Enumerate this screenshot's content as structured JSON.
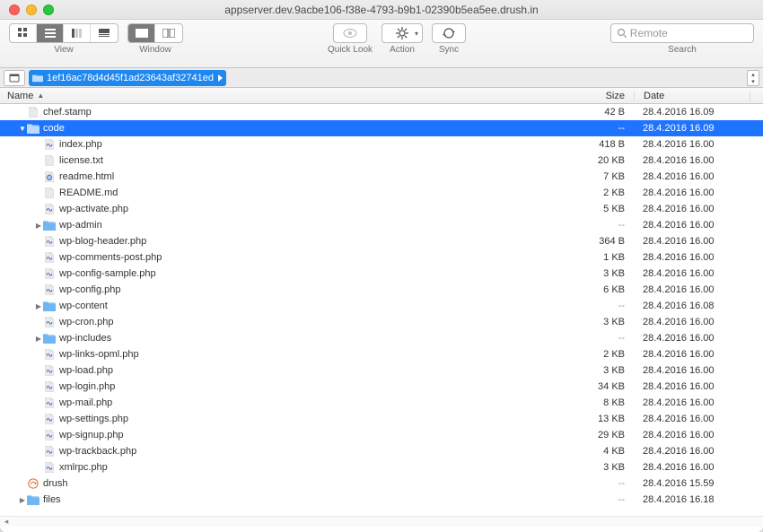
{
  "window": {
    "title": "appserver.dev.9acbe106-f38e-4793-b9b1-02390b5ea5ee.drush.in"
  },
  "toolbar": {
    "view_label": "View",
    "window_label": "Window",
    "quicklook_label": "Quick Look",
    "action_label": "Action",
    "sync_label": "Sync",
    "search_label": "Search",
    "search_placeholder": "Remote"
  },
  "pathbar": {
    "crumb": "1ef16ac78d4d45f1ad23643af32741ed"
  },
  "columns": {
    "name": "Name",
    "size": "Size",
    "date": "Date"
  },
  "rows": [
    {
      "indent": 0,
      "icon": "file",
      "disclosure": "",
      "name": "chef.stamp",
      "size": "42 B",
      "date": "28.4.2016 16.09"
    },
    {
      "indent": 0,
      "icon": "folder",
      "disclosure": "open",
      "name": "code",
      "size": "--",
      "date": "28.4.2016 16.09",
      "selected": true
    },
    {
      "indent": 1,
      "icon": "php",
      "disclosure": "",
      "name": "index.php",
      "size": "418 B",
      "date": "28.4.2016 16.00"
    },
    {
      "indent": 1,
      "icon": "file",
      "disclosure": "",
      "name": "license.txt",
      "size": "20 KB",
      "date": "28.4.2016 16.00"
    },
    {
      "indent": 1,
      "icon": "html",
      "disclosure": "",
      "name": "readme.html",
      "size": "7 KB",
      "date": "28.4.2016 16.00"
    },
    {
      "indent": 1,
      "icon": "file",
      "disclosure": "",
      "name": "README.md",
      "size": "2 KB",
      "date": "28.4.2016 16.00"
    },
    {
      "indent": 1,
      "icon": "php",
      "disclosure": "",
      "name": "wp-activate.php",
      "size": "5 KB",
      "date": "28.4.2016 16.00"
    },
    {
      "indent": 1,
      "icon": "folder",
      "disclosure": "closed",
      "name": "wp-admin",
      "size": "--",
      "date": "28.4.2016 16.00"
    },
    {
      "indent": 1,
      "icon": "php",
      "disclosure": "",
      "name": "wp-blog-header.php",
      "size": "364 B",
      "date": "28.4.2016 16.00"
    },
    {
      "indent": 1,
      "icon": "php",
      "disclosure": "",
      "name": "wp-comments-post.php",
      "size": "1 KB",
      "date": "28.4.2016 16.00"
    },
    {
      "indent": 1,
      "icon": "php",
      "disclosure": "",
      "name": "wp-config-sample.php",
      "size": "3 KB",
      "date": "28.4.2016 16.00"
    },
    {
      "indent": 1,
      "icon": "php",
      "disclosure": "",
      "name": "wp-config.php",
      "size": "6 KB",
      "date": "28.4.2016 16.00"
    },
    {
      "indent": 1,
      "icon": "folder",
      "disclosure": "closed",
      "name": "wp-content",
      "size": "--",
      "date": "28.4.2016 16.08"
    },
    {
      "indent": 1,
      "icon": "php",
      "disclosure": "",
      "name": "wp-cron.php",
      "size": "3 KB",
      "date": "28.4.2016 16.00"
    },
    {
      "indent": 1,
      "icon": "folder",
      "disclosure": "closed",
      "name": "wp-includes",
      "size": "--",
      "date": "28.4.2016 16.00"
    },
    {
      "indent": 1,
      "icon": "php",
      "disclosure": "",
      "name": "wp-links-opml.php",
      "size": "2 KB",
      "date": "28.4.2016 16.00"
    },
    {
      "indent": 1,
      "icon": "php",
      "disclosure": "",
      "name": "wp-load.php",
      "size": "3 KB",
      "date": "28.4.2016 16.00"
    },
    {
      "indent": 1,
      "icon": "php",
      "disclosure": "",
      "name": "wp-login.php",
      "size": "34 KB",
      "date": "28.4.2016 16.00"
    },
    {
      "indent": 1,
      "icon": "php",
      "disclosure": "",
      "name": "wp-mail.php",
      "size": "8 KB",
      "date": "28.4.2016 16.00"
    },
    {
      "indent": 1,
      "icon": "php",
      "disclosure": "",
      "name": "wp-settings.php",
      "size": "13 KB",
      "date": "28.4.2016 16.00"
    },
    {
      "indent": 1,
      "icon": "php",
      "disclosure": "",
      "name": "wp-signup.php",
      "size": "29 KB",
      "date": "28.4.2016 16.00"
    },
    {
      "indent": 1,
      "icon": "php",
      "disclosure": "",
      "name": "wp-trackback.php",
      "size": "4 KB",
      "date": "28.4.2016 16.00"
    },
    {
      "indent": 1,
      "icon": "php",
      "disclosure": "",
      "name": "xmlrpc.php",
      "size": "3 KB",
      "date": "28.4.2016 16.00"
    },
    {
      "indent": 0,
      "icon": "drush",
      "disclosure": "",
      "name": "drush",
      "size": "--",
      "date": "28.4.2016 15.59"
    },
    {
      "indent": 0,
      "icon": "folder",
      "disclosure": "closed",
      "name": "files",
      "size": "--",
      "date": "28.4.2016 16.18"
    }
  ]
}
